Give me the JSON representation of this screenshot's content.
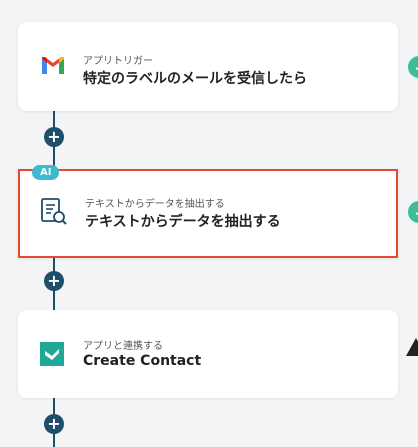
{
  "steps": [
    {
      "subtitle": "アプリトリガー",
      "title": "特定のラベルのメールを受信したら",
      "icon": "gmail-icon"
    },
    {
      "badge": "AI",
      "subtitle": "テキストからデータを抽出する",
      "title": "テキストからデータを抽出する",
      "icon": "document-search-icon",
      "selected": true
    },
    {
      "subtitle": "アプリと連携する",
      "title": "Create Contact",
      "icon": "app-logo-icon"
    }
  ],
  "add_step_symbol": "+",
  "check_symbol": "✓",
  "colors": {
    "connector": "#1f4e6b",
    "selected_border": "#e64a2e",
    "ai_badge": "#3bbad0",
    "check": "#3bbd9a",
    "app_logo": "#1fa895"
  }
}
